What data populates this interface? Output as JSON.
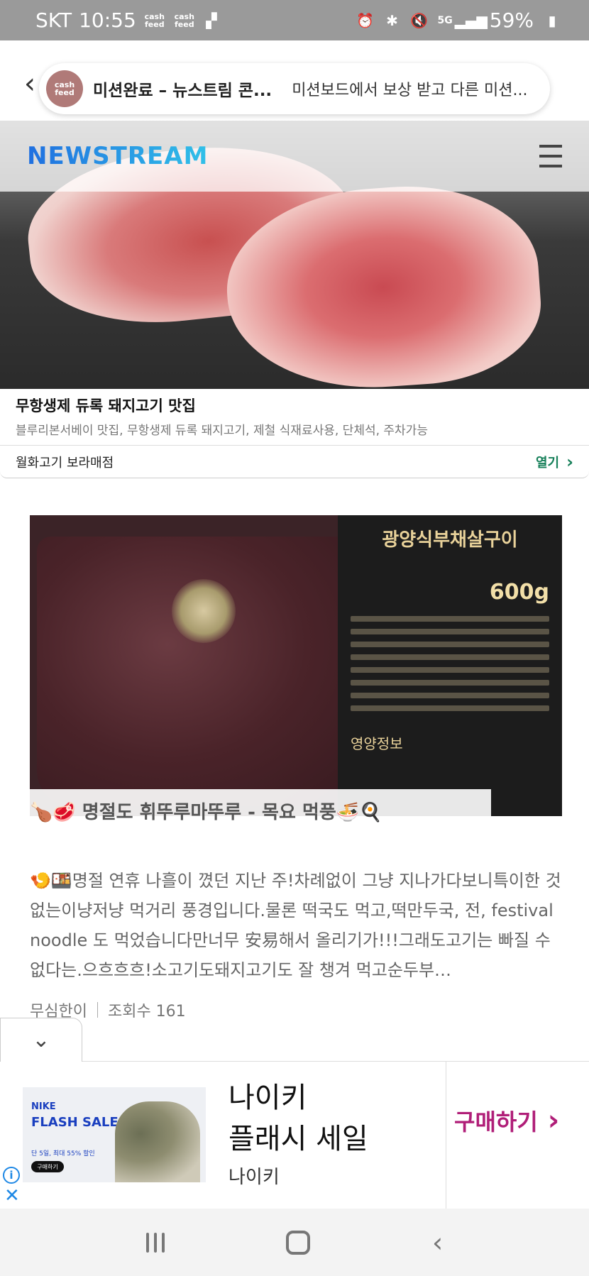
{
  "status_bar": {
    "carrier": "SKT",
    "time": "10:55",
    "cash_feed_label": "cash feed",
    "network": "5G",
    "battery": "59%"
  },
  "cashfeed_pill": {
    "logo_text": "cash feed",
    "title": "미션완료 – 뉴스트림 콘...",
    "description": "미션보드에서 보상 받고 다른 미션..."
  },
  "header": {
    "brand": "NEWSTREAM"
  },
  "ad1": {
    "title": "무항생제 듀록 돼지고기 맛집",
    "subtitle": "블루리본서베이 맛집, 무항생제 듀록 돼지고기, 제철 식재료사용, 단체석, 주차가능",
    "advertiser": "월화고기 보라매점",
    "open_label": "열기"
  },
  "post": {
    "package_name": "광양식부채살구이",
    "package_weight": "600g",
    "package_nutrition": "영양정보",
    "title": "🍗🥩 명절도 휘뚜루마뚜루 - 목요 먹풍🍜🍳",
    "body": "🍤🍱명절 연휴 나흘이 꼈던 지난 주!차례없이 그냥 지나가다보니특이한 것 없는이냥저냥 먹거리 풍경입니다.물론 떡국도 먹고,떡만두국, 전, festival noodle 도 먹었습니다만너무 安易해서 올리기가!!!그래도고기는 빠질 수 없다는.으흐흐흐!소고기도돼지고기도 잘 챙겨 먹고순두부…",
    "author": "무심한이",
    "views": "조회수 161"
  },
  "ad2": {
    "image_brand": "NIKE",
    "image_headline": "FLASH SALE",
    "image_sub": "단 5일, 최대 55% 할인",
    "image_button": "구매하기",
    "headline_line1": "나이키",
    "headline_line2": "플래시 세일",
    "brand": "나이키",
    "buy_label": "구매하기"
  }
}
